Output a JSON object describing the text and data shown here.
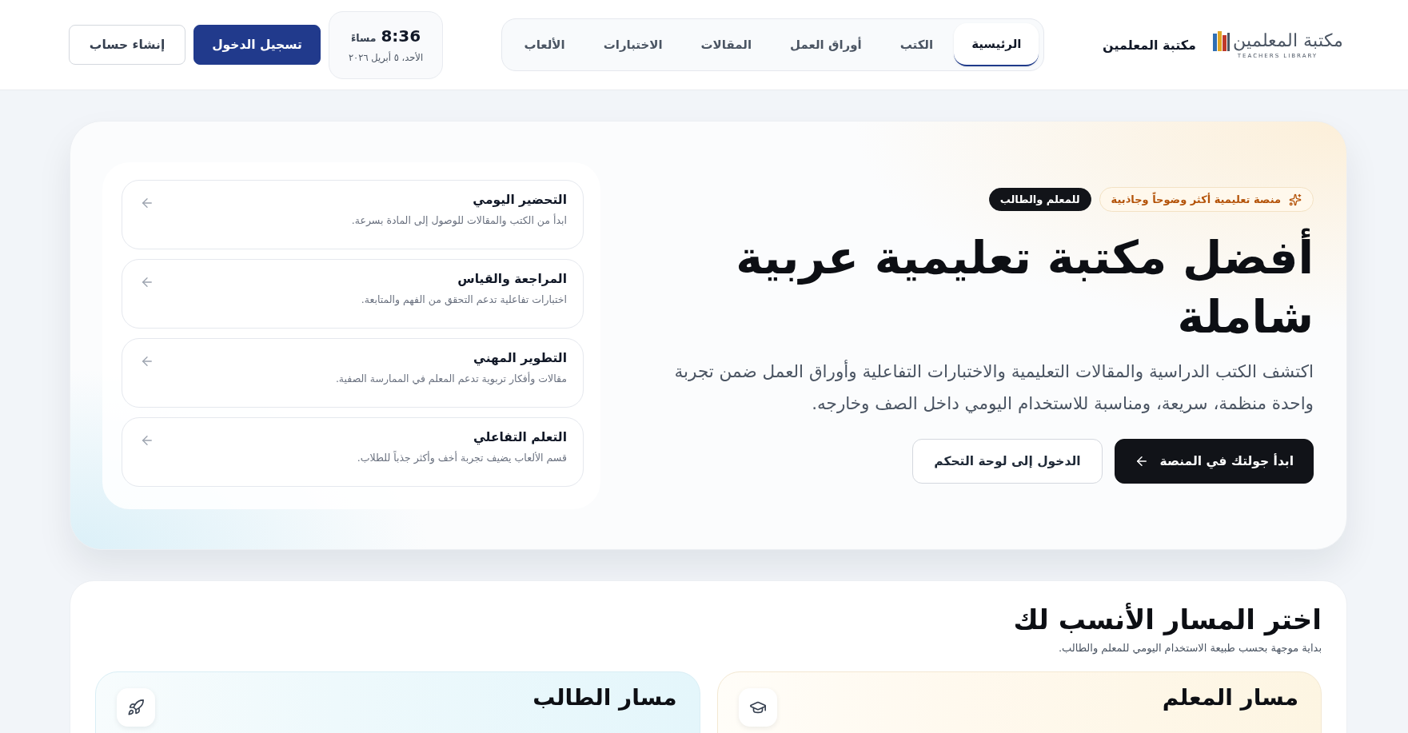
{
  "header": {
    "logo": {
      "wordmark": "مكتبة المعلمين",
      "tagline": "TEACHERS LIBRARY"
    },
    "brand_name": "مكتبة المعلمين",
    "nav_tabs": [
      {
        "label": "الرئيسية",
        "selected": true
      },
      {
        "label": "الكتب",
        "selected": false
      },
      {
        "label": "أوراق العمل",
        "selected": false
      },
      {
        "label": "المقالات",
        "selected": false
      },
      {
        "label": "الاختبارات",
        "selected": false
      },
      {
        "label": "الألعاب",
        "selected": false
      }
    ],
    "clock": {
      "time": "8:36",
      "period": "مساءً",
      "date": "الأحد، ٥ أبريل ٢٠٢٦"
    },
    "buttons": [
      {
        "label": "تسجيل الدخول",
        "kind": "primary"
      },
      {
        "label": "إنشاء حساب",
        "kind": "outline"
      }
    ]
  },
  "hero": {
    "badges": [
      {
        "label": "منصة تعليمية أكثر وضوحاً وجاذبية",
        "kind": "highlight"
      },
      {
        "label": "للمعلم والطالب",
        "kind": "dark"
      }
    ],
    "headline": "أفضل مكتبة تعليمية عربية شاملة",
    "description": "اكتشف الكتب الدراسية والمقالات التعليمية والاختبارات التفاعلية وأوراق العمل ضمن تجربة واحدة منظمة، سريعة، ومناسبة للاستخدام اليومي داخل الصف وخارجه.",
    "buttons": [
      {
        "label": "ابدأ جولتك في المنصة",
        "kind": "primary"
      },
      {
        "label": "الدخول إلى لوحة التحكم",
        "kind": "outline"
      }
    ],
    "feature_cards": [
      {
        "title": "التحضير اليومي",
        "description": "ابدأ من الكتب والمقالات للوصول إلى المادة بسرعة."
      },
      {
        "title": "المراجعة والقياس",
        "description": "اختبارات تفاعلية تدعم التحقق من الفهم والمتابعة."
      },
      {
        "title": "التطوير المهني",
        "description": "مقالات وأفكار تربوية تدعم المعلم في الممارسة الصفية."
      },
      {
        "title": "التعلم التفاعلي",
        "description": "قسم الألعاب يضيف تجربة أخف وأكثر جذباً للطلاب."
      }
    ]
  },
  "paths_section": {
    "title": "اختر المسار الأنسب لك",
    "subtitle": "بداية موجهة بحسب طبيعة الاستخدام اليومي للمعلم والطالب.",
    "cards": [
      {
        "title": "مسار المعلم",
        "kind": "teacher"
      },
      {
        "title": "مسار الطالب",
        "kind": "student"
      }
    ]
  }
}
